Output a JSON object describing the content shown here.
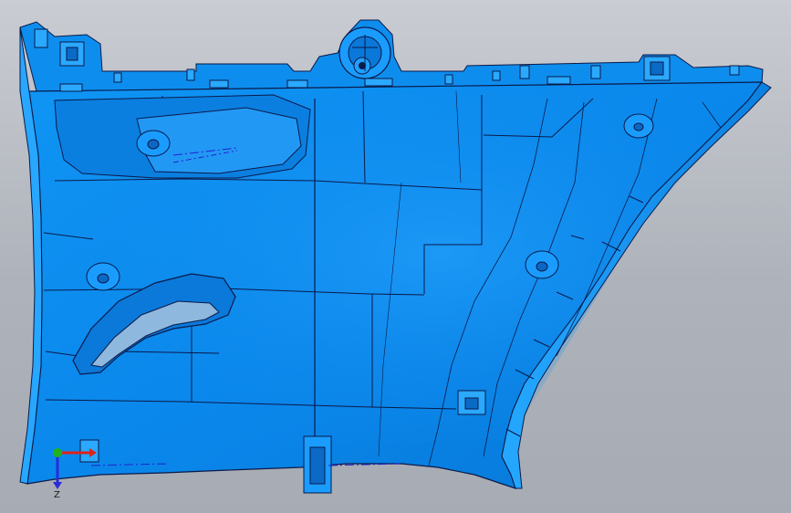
{
  "viewport": {
    "background_top": "#c9ccd2",
    "background_bottom": "#a7abb3"
  },
  "model": {
    "name": "",
    "body_color": "#0a8ff0",
    "body_dark": "#0570c8",
    "body_light": "#3fb4ff",
    "edge_color": "#0b1a4a"
  },
  "triad": {
    "x_color": "#e0221a",
    "y_color": "#1fb31f",
    "z_color": "#2a2ad8",
    "z_label": "Z"
  }
}
